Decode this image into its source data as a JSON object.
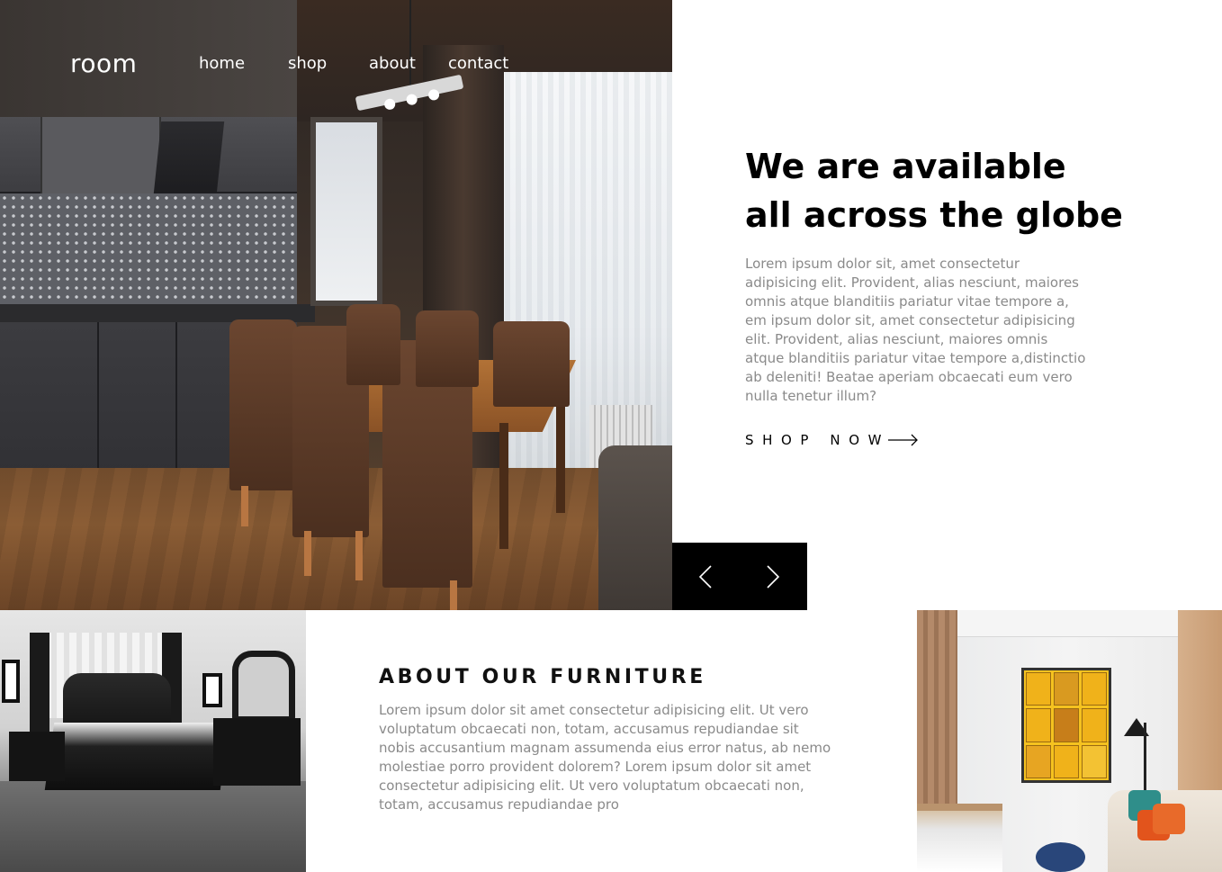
{
  "nav": {
    "logo": "room",
    "links": [
      "home",
      "shop",
      "about",
      "contact"
    ]
  },
  "hero": {
    "image_alt": "kitchen-dining-room-photo",
    "title": "We are available all across the globe",
    "body": "Lorem ipsum dolor sit, amet consectetur adipisicing elit. Provident, alias nesciunt, maiores omnis atque blanditiis pariatur vitae tempore a, em ipsum dolor sit, amet consectetur adipisicing elit. Provident, alias nesciunt, maiores omnis atque blanditiis pariatur vitae tempore a,distinctio ab deleniti! Beatae aperiam obcaecati eum vero nulla tenetur illum?",
    "cta_label": "SHOP NOW",
    "cta_icon": "arrow-right-icon"
  },
  "slider": {
    "prev_icon": "chevron-left-icon",
    "next_icon": "chevron-right-icon"
  },
  "about": {
    "title": "ABOUT OUR FURNITURE",
    "body": "Lorem ipsum dolor sit amet consectetur adipisicing elit. Ut vero voluptatum obcaecati non, totam, accusamus repudiandae sit nobis accusantium magnam assumenda eius error natus, ab nemo molestiae porro provident dolorem? Lorem ipsum dolor sit amet consectetur adipisicing elit. Ut vero voluptatum obcaecati non, totam, accusamus repudiandae pro",
    "left_image": "bedroom-photo",
    "right_image": "living-room-photo"
  },
  "colors": {
    "text_primary": "#000000",
    "text_muted": "#8a8a8a",
    "slider_bg": "#000000",
    "page_bg": "#ffffff"
  }
}
